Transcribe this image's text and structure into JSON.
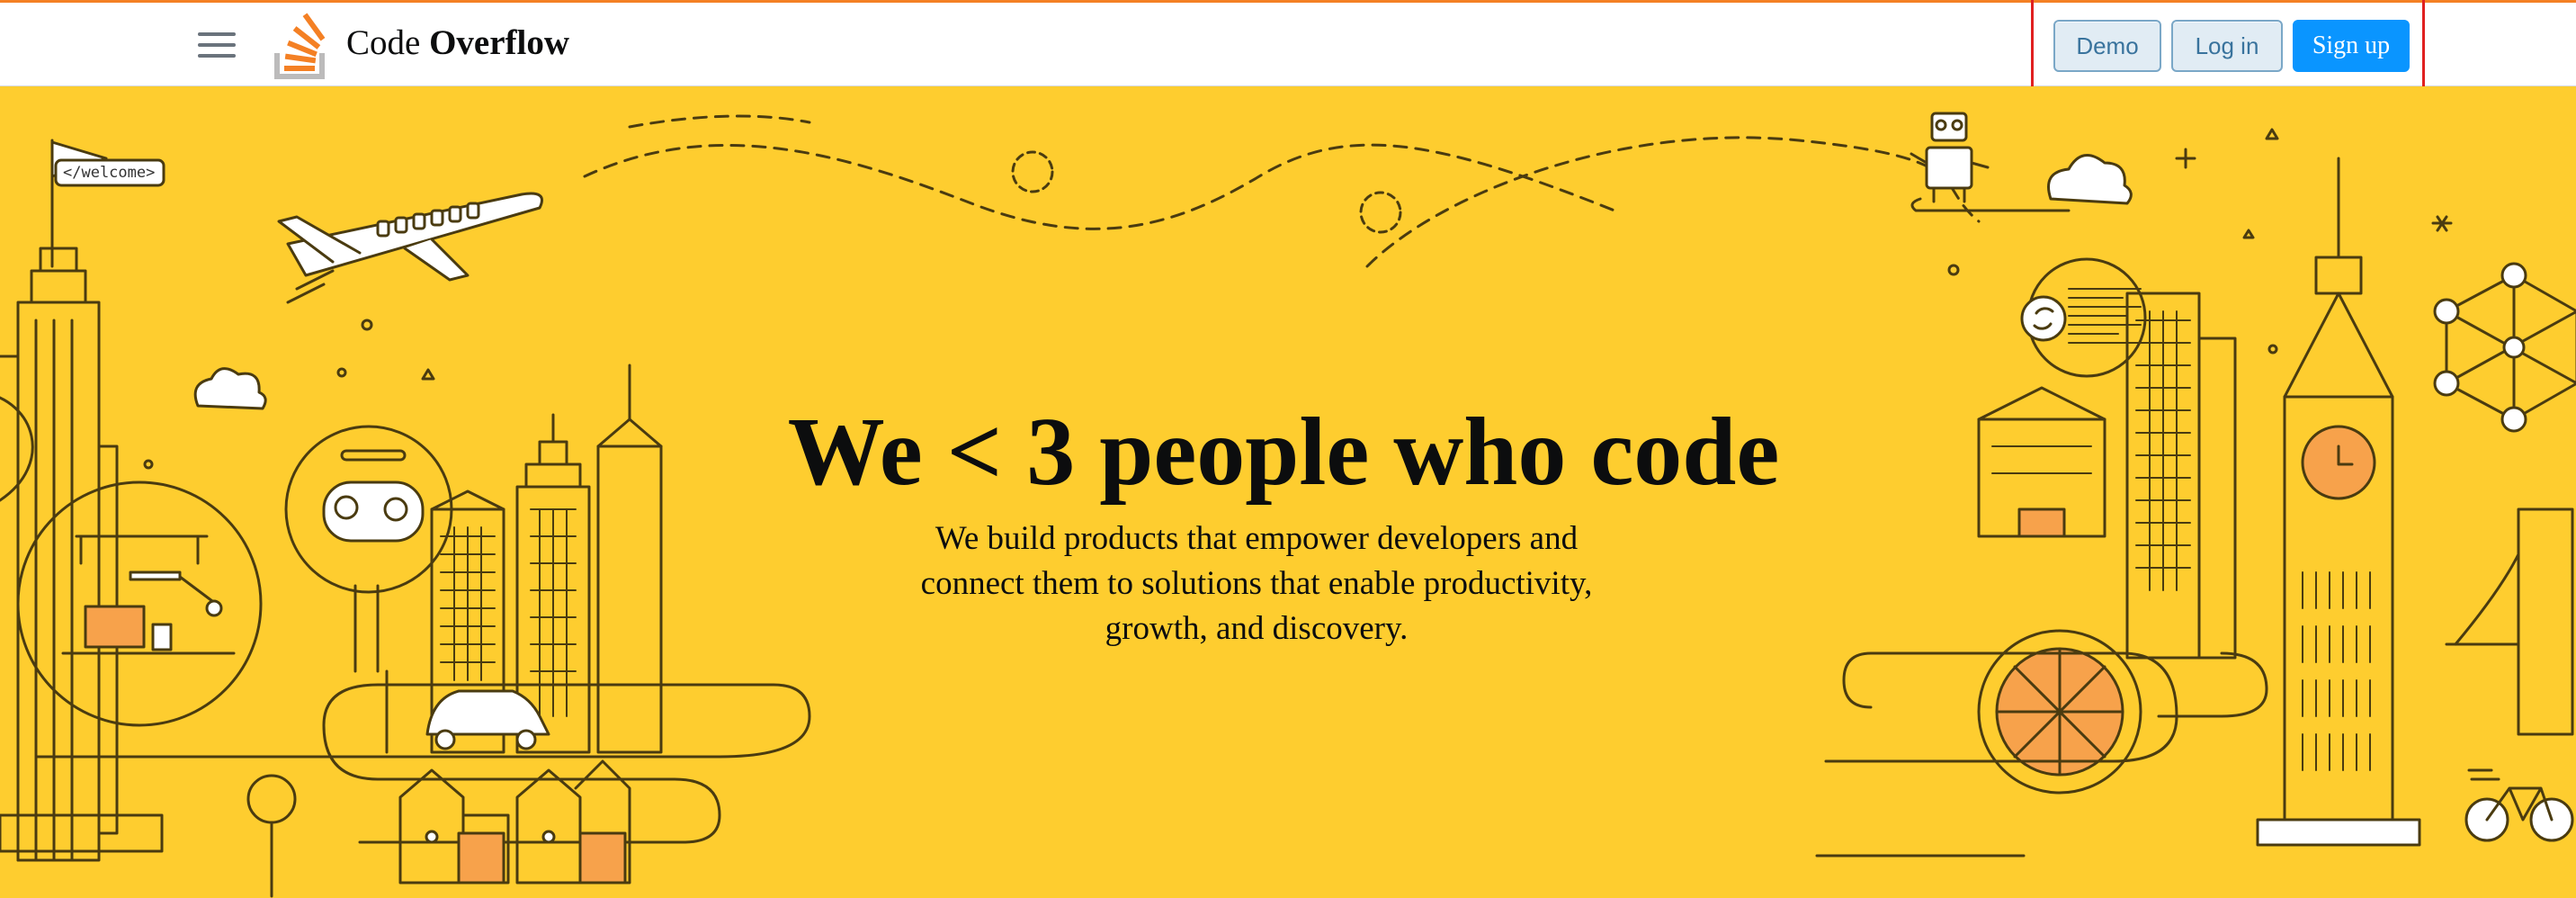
{
  "header": {
    "brand_light": "Code ",
    "brand_bold": "Overflow",
    "menu_icon": "hamburger-menu-icon",
    "logo_icon": "stack-logo-icon",
    "buttons": {
      "demo": "Demo",
      "login": "Log in",
      "signup": "Sign up"
    }
  },
  "hero": {
    "headline": "We < 3 people who code",
    "subtext": "We build products that empower developers and connect them to solutions that enable productivity, growth, and discovery.",
    "flag_text": "</welcome>",
    "background_color": "#fecd2f"
  },
  "colors": {
    "accent_orange": "#f48024",
    "primary_blue": "#0a95ff",
    "secondary_bg": "#e1ecf4",
    "secondary_text": "#39739d",
    "illustration_stroke": "#4a3b10",
    "highlight_red": "#e02020"
  }
}
